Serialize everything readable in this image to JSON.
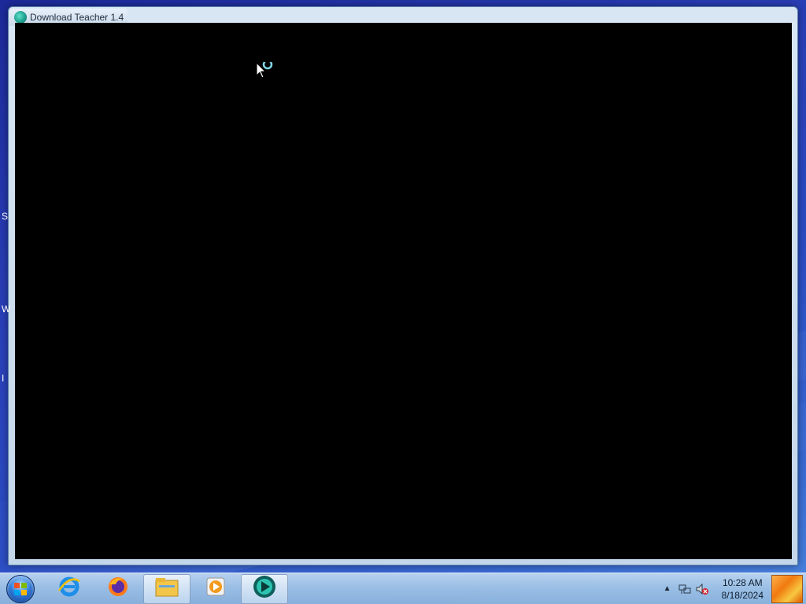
{
  "window": {
    "title": "Download Teacher 1.4"
  },
  "desktop": {
    "edge_glyphs": [
      "S",
      "W",
      "I"
    ]
  },
  "taskbar": {
    "start_label": "Start",
    "pinned": [
      {
        "name": "internet-explorer-icon",
        "active": false
      },
      {
        "name": "firefox-icon",
        "active": false
      },
      {
        "name": "file-explorer-icon",
        "active": true
      },
      {
        "name": "media-player-icon",
        "active": false
      },
      {
        "name": "download-teacher-icon",
        "active": true
      }
    ],
    "tray": {
      "show_hidden_icons": "▲",
      "network_icon": "network-icon",
      "volume_icon": "volume-muted-icon"
    },
    "clock": {
      "time": "10:28 AM",
      "date": "8/18/2024"
    }
  },
  "colors": {
    "desktop": "#2b4cc4",
    "window_frame": "#c3d6ea",
    "content": "#000000",
    "taskbar": "#a0c3e6"
  }
}
